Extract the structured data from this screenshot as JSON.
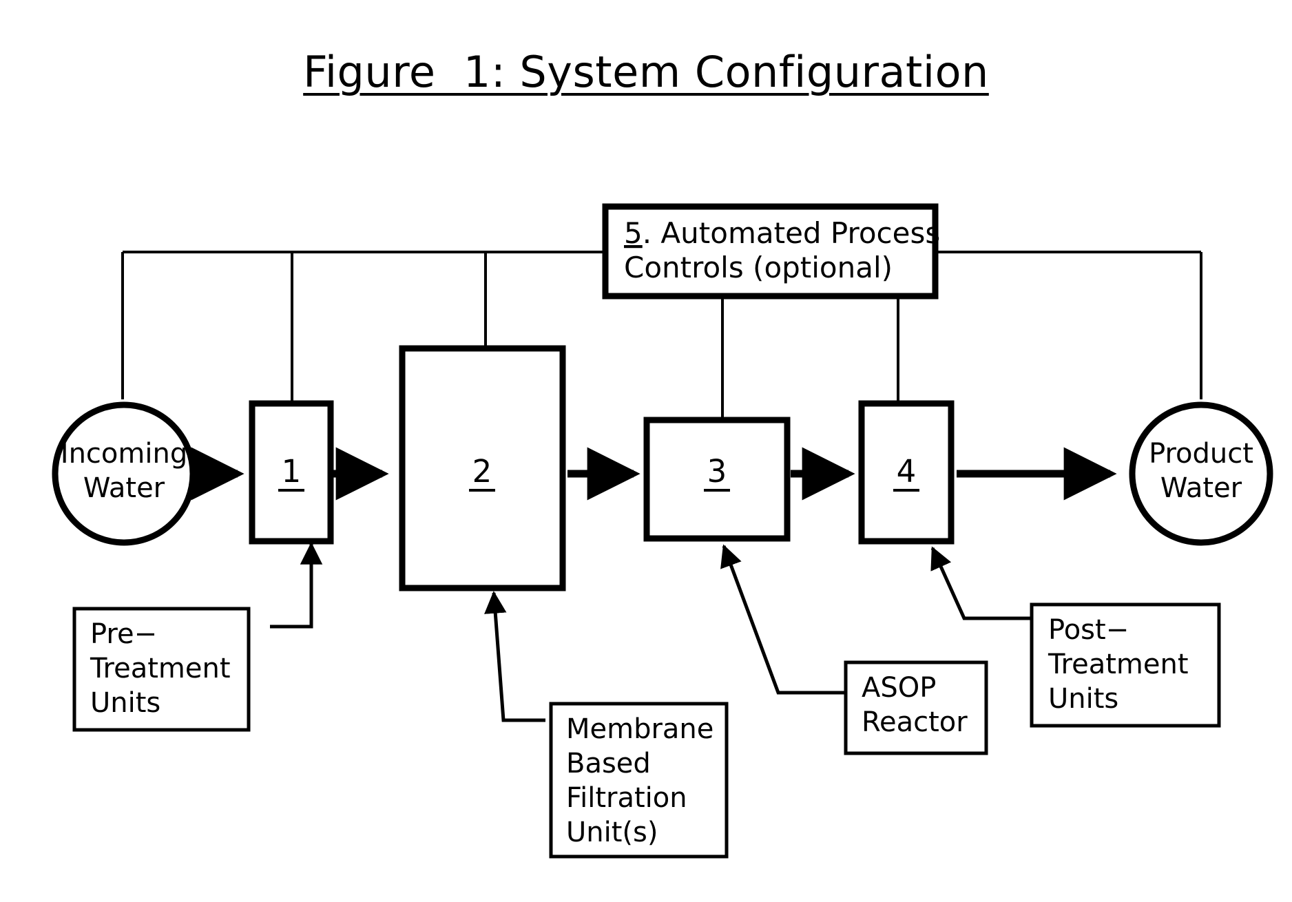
{
  "figure": {
    "title_prefix": "Figure  1: System Configuration",
    "title_underlined": "Figure  1: System Configuration"
  },
  "endpoints": {
    "incoming": {
      "line1": "Incoming",
      "line2": "Water"
    },
    "product": {
      "line1": "Product",
      "line2": "Water"
    }
  },
  "process_nodes": [
    {
      "number": "1",
      "name": "pre-treatment-units"
    },
    {
      "number": "2",
      "name": "membrane-filtration-unit"
    },
    {
      "number": "3",
      "name": "asop-reactor"
    },
    {
      "number": "4",
      "name": "post-treatment-units"
    }
  ],
  "controls_box": {
    "number": "5",
    "line1_rest": ". Automated Process",
    "line2": "Controls (optional)"
  },
  "callouts": {
    "pre_treatment": {
      "line1": "Pre−",
      "line2": "Treatment",
      "line3": "Units"
    },
    "membrane": {
      "line1": "Membrane",
      "line2": "Based",
      "line3": "Filtration",
      "line4": "Unit(s)"
    },
    "asop": {
      "line1": "ASOP",
      "line2": "Reactor"
    },
    "post_treatment": {
      "line1": "Post−",
      "line2": "Treatment",
      "line3": "Units"
    }
  },
  "colors": {
    "stroke": "#000000",
    "background": "#ffffff"
  }
}
